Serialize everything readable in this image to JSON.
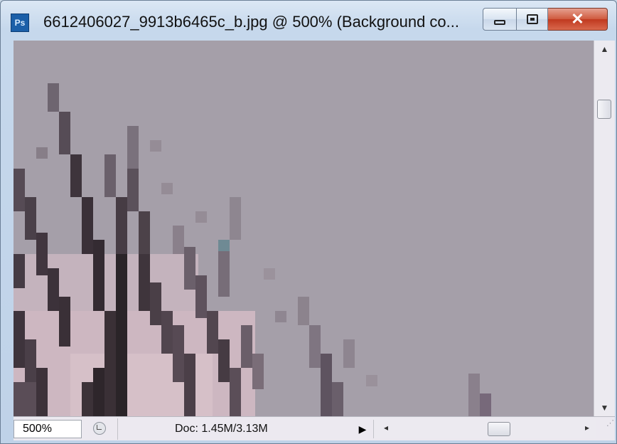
{
  "window": {
    "app_icon_label": "Ps",
    "title": "6612406027_9913b6465c_b.jpg @ 500% (Background co...",
    "controls": {
      "minimize": "minimize-icon",
      "maximize": "maximize-icon",
      "close": "close-icon"
    }
  },
  "canvas": {
    "image_description_icon": "pixelated-photo-tree-branches",
    "background_color": "#a59fa9"
  },
  "statusbar": {
    "zoom_value": "500%",
    "doc_info": "Doc: 1.45M/3.13M",
    "menu_arrow": "▶",
    "scroll_left": "◂",
    "scroll_right": "▸"
  },
  "scrollbar": {
    "up": "▲",
    "down": "▼"
  }
}
